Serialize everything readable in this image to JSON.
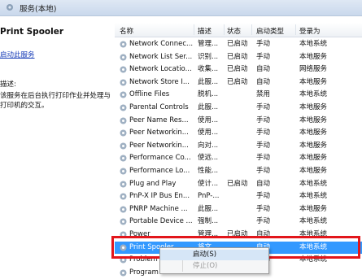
{
  "window": {
    "title": "服务(本地)"
  },
  "left": {
    "service_title": "Print Spooler",
    "link": "启动此服务",
    "desc_label": "描述:",
    "desc_text": "该服务在后台执行打印作业并处理与打印机的交互。"
  },
  "columns": {
    "name": "名称",
    "desc": "描述",
    "status": "状态",
    "startup": "启动类型",
    "logon": "登录为"
  },
  "rows": [
    {
      "name": "Network Connec...",
      "desc": "管理...",
      "status": "已启动",
      "startup": "手动",
      "logon": "本地系统"
    },
    {
      "name": "Network List Ser...",
      "desc": "识别...",
      "status": "已启动",
      "startup": "手动",
      "logon": "本地服务"
    },
    {
      "name": "Network Locatio...",
      "desc": "收集...",
      "status": "已启动",
      "startup": "自动",
      "logon": "网络服务"
    },
    {
      "name": "Network Store I...",
      "desc": "此服...",
      "status": "已启动",
      "startup": "自动",
      "logon": "本地服务"
    },
    {
      "name": "Offline Files",
      "desc": "脱机...",
      "status": "",
      "startup": "禁用",
      "logon": "本地系统"
    },
    {
      "name": "Parental Controls",
      "desc": "此服...",
      "status": "",
      "startup": "手动",
      "logon": "本地服务"
    },
    {
      "name": "Peer Name Res...",
      "desc": "使用...",
      "status": "",
      "startup": "手动",
      "logon": "本地服务"
    },
    {
      "name": "Peer Networkin...",
      "desc": "使用...",
      "status": "",
      "startup": "手动",
      "logon": "本地服务"
    },
    {
      "name": "Peer Networkin...",
      "desc": "向对...",
      "status": "",
      "startup": "手动",
      "logon": "本地服务"
    },
    {
      "name": "Performance Co...",
      "desc": "使远...",
      "status": "",
      "startup": "手动",
      "logon": "本地服务"
    },
    {
      "name": "Performance Lo...",
      "desc": "性能...",
      "status": "",
      "startup": "手动",
      "logon": "本地服务"
    },
    {
      "name": "Plug and Play",
      "desc": "使计...",
      "status": "已启动",
      "startup": "自动",
      "logon": "本地系统"
    },
    {
      "name": "PnP-X IP Bus En...",
      "desc": "PnP-...",
      "status": "",
      "startup": "手动",
      "logon": "本地系统"
    },
    {
      "name": "PNRP Machine ...",
      "desc": "此服...",
      "status": "",
      "startup": "手动",
      "logon": "本地服务"
    },
    {
      "name": "Portable Device ...",
      "desc": "强制...",
      "status": "",
      "startup": "手动",
      "logon": "本地系统"
    },
    {
      "name": "Power",
      "desc": "管理...",
      "status": "已启动",
      "startup": "自动",
      "logon": "本地系统"
    },
    {
      "name": "Print Spooler",
      "desc": "将文...",
      "status": "",
      "startup": "自动",
      "logon": "本地系统"
    },
    {
      "name": "Problem Re...",
      "desc": "",
      "status": "",
      "startup": "手动",
      "logon": "本地系统"
    },
    {
      "name": "Program Co...",
      "desc": "",
      "status": "",
      "startup": "",
      "logon": ""
    }
  ],
  "context_menu": {
    "items": [
      {
        "label": "启动(S)"
      },
      {
        "label": "停止(O)"
      }
    ]
  },
  "colors": {
    "highlight": "#3399ff",
    "red_box": "#e2161b",
    "link": "#1a3fb8"
  }
}
